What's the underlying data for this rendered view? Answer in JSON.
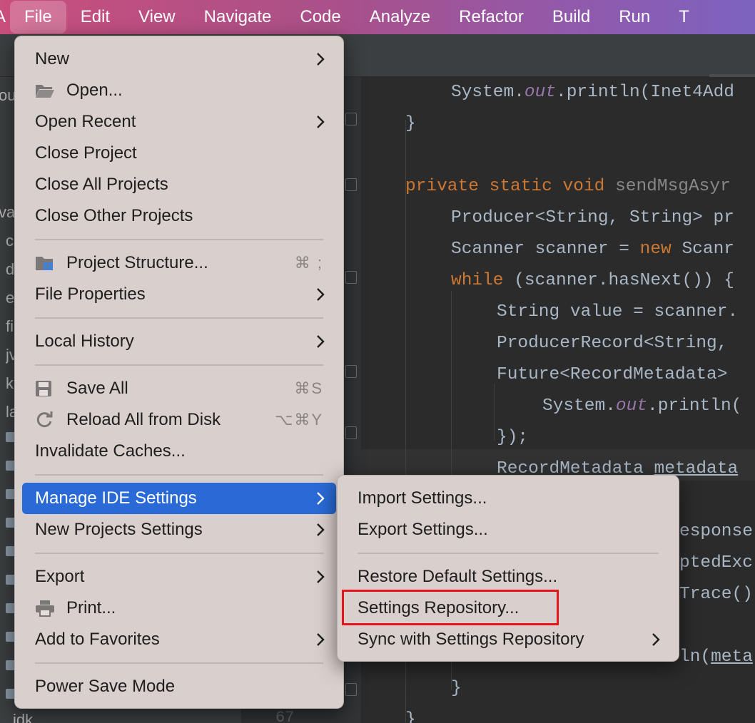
{
  "menubar": {
    "items": [
      {
        "label": "A"
      },
      {
        "label": "File"
      },
      {
        "label": "Edit"
      },
      {
        "label": "View"
      },
      {
        "label": "Navigate"
      },
      {
        "label": "Code"
      },
      {
        "label": "Analyze"
      },
      {
        "label": "Refactor"
      },
      {
        "label": "Build"
      },
      {
        "label": "Run"
      },
      {
        "label": "T"
      }
    ],
    "active": "File"
  },
  "project_pane": {
    "rows": [
      "ou",
      "va",
      "c",
      "d",
      "e",
      "fi",
      "jv",
      "k",
      "la",
      "idk"
    ]
  },
  "gutter": {
    "last_line_number": "67"
  },
  "editor": {
    "lines": [
      {
        "indent": 2,
        "parts": [
          {
            "t": "System.",
            "c": ""
          },
          {
            "t": "out",
            "c": "fld"
          },
          {
            "t": ".println(Inet4Add",
            "c": ""
          }
        ]
      },
      {
        "indent": 1,
        "parts": [
          {
            "t": "}",
            "c": ""
          }
        ]
      },
      {
        "indent": 0,
        "parts": []
      },
      {
        "indent": 1,
        "parts": [
          {
            "t": "private static void ",
            "c": "kw"
          },
          {
            "t": "sendMsgAsyr",
            "c": "fn"
          }
        ]
      },
      {
        "indent": 2,
        "parts": [
          {
            "t": "Producer<String, String> pr",
            "c": ""
          }
        ]
      },
      {
        "indent": 2,
        "parts": [
          {
            "t": "Scanner scanner = ",
            "c": ""
          },
          {
            "t": "new ",
            "c": "kw"
          },
          {
            "t": "Scanr",
            "c": ""
          }
        ]
      },
      {
        "indent": 2,
        "parts": [
          {
            "t": "while ",
            "c": "kw"
          },
          {
            "t": "(scanner.hasNext()) {",
            "c": ""
          }
        ]
      },
      {
        "indent": 3,
        "parts": [
          {
            "t": "String value = scanner.",
            "c": ""
          }
        ]
      },
      {
        "indent": 3,
        "parts": [
          {
            "t": "ProducerRecord<String, ",
            "c": ""
          }
        ]
      },
      {
        "indent": 3,
        "parts": [
          {
            "t": "Future<RecordMetadata> ",
            "c": ""
          }
        ]
      },
      {
        "indent": 4,
        "parts": [
          {
            "t": "System.",
            "c": ""
          },
          {
            "t": "out",
            "c": "fld"
          },
          {
            "t": ".println(",
            "c": ""
          }
        ]
      },
      {
        "indent": 3,
        "parts": [
          {
            "t": "});",
            "c": ""
          }
        ]
      },
      {
        "indent": 3,
        "parts": [
          {
            "t": "RecordMetadata ",
            "c": ""
          },
          {
            "t": "metadata",
            "c": "ul"
          }
        ]
      },
      {
        "indent": 0,
        "parts": []
      },
      {
        "indent": 5,
        "parts": [
          {
            "t": "esponse",
            "c": ""
          }
        ]
      },
      {
        "indent": 5,
        "parts": [
          {
            "t": "ptedExc",
            "c": ""
          }
        ]
      },
      {
        "indent": 5,
        "parts": [
          {
            "t": "Trace()",
            "c": ""
          }
        ]
      },
      {
        "indent": 0,
        "parts": []
      },
      {
        "indent": 5,
        "parts": [
          {
            "t": "ln(",
            "c": ""
          },
          {
            "t": "meta",
            "c": "ul"
          }
        ]
      },
      {
        "indent": 2,
        "parts": [
          {
            "t": "}",
            "c": ""
          }
        ]
      },
      {
        "indent": 1,
        "parts": [
          {
            "t": "}",
            "c": ""
          }
        ]
      }
    ]
  },
  "file_menu": {
    "items": [
      {
        "label": "New",
        "submenu": true
      },
      {
        "label": "Open...",
        "icon": "folder-open-icon"
      },
      {
        "label": "Open Recent",
        "submenu": true
      },
      {
        "label": "Close Project"
      },
      {
        "label": "Close All Projects"
      },
      {
        "label": "Close Other Projects"
      },
      {
        "label": "Project Structure...",
        "icon": "project-structure-icon",
        "shortcut": "⌘ ;"
      },
      {
        "label": "File Properties",
        "submenu": true
      },
      {
        "label": "Local History",
        "submenu": true
      },
      {
        "label": "Save All",
        "icon": "save-icon",
        "shortcut": "⌘S"
      },
      {
        "label": "Reload All from Disk",
        "icon": "reload-icon",
        "shortcut": "⌥⌘Y"
      },
      {
        "label": "Invalidate Caches..."
      },
      {
        "label": "Manage IDE Settings",
        "submenu": true,
        "selected": true
      },
      {
        "label": "New Projects Settings",
        "submenu": true
      },
      {
        "label": "Export",
        "submenu": true
      },
      {
        "label": "Print...",
        "icon": "print-icon"
      },
      {
        "label": "Add to Favorites",
        "submenu": true
      },
      {
        "label": "Power Save Mode"
      }
    ]
  },
  "settings_submenu": {
    "items": [
      {
        "label": "Import Settings..."
      },
      {
        "label": "Export Settings..."
      },
      {
        "label": "Restore Default Settings..."
      },
      {
        "label": "Settings Repository...",
        "highlighted": true
      },
      {
        "label": "Sync with Settings Repository",
        "submenu": true
      }
    ]
  },
  "colors": {
    "selection": "#2a6ad6",
    "highlight_box": "#e8141c",
    "menu_bg": "#d9cfcd"
  }
}
